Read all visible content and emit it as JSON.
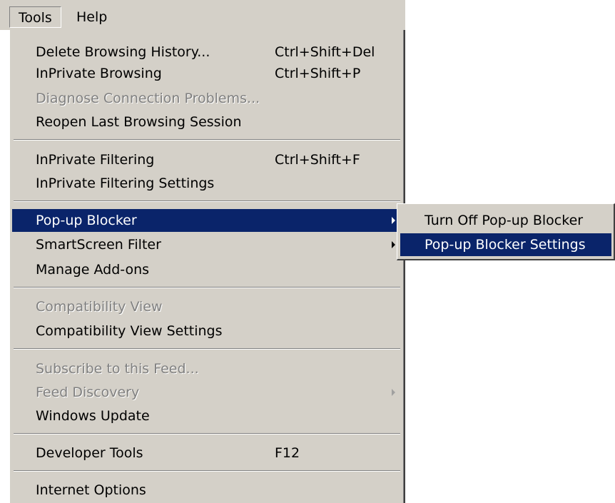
{
  "menubar": {
    "tools_label": "Tools",
    "help_label": "Help"
  },
  "tools_menu": {
    "items": [
      {
        "label": "Delete Browsing History...",
        "shortcut": "Ctrl+Shift+Del"
      },
      {
        "label": "InPrivate Browsing",
        "shortcut": "Ctrl+Shift+P"
      },
      {
        "label": "Diagnose Connection Problems...",
        "disabled": true
      },
      {
        "label": "Reopen Last Browsing Session"
      },
      {
        "label": "InPrivate Filtering",
        "shortcut": "Ctrl+Shift+F"
      },
      {
        "label": "InPrivate Filtering Settings"
      },
      {
        "label": "Pop-up Blocker",
        "submenu": true,
        "selected": true
      },
      {
        "label": "SmartScreen Filter",
        "submenu": true
      },
      {
        "label": "Manage Add-ons"
      },
      {
        "label": "Compatibility View",
        "disabled": true
      },
      {
        "label": "Compatibility View Settings"
      },
      {
        "label": "Subscribe to this Feed...",
        "disabled": true
      },
      {
        "label": "Feed Discovery",
        "submenu": true,
        "disabled": true
      },
      {
        "label": "Windows Update"
      },
      {
        "label": "Developer Tools",
        "shortcut": "F12"
      },
      {
        "label": "Internet Options"
      }
    ]
  },
  "popup_blocker_submenu": {
    "items": [
      {
        "label": "Turn Off Pop-up Blocker"
      },
      {
        "label": "Pop-up Blocker Settings",
        "selected": true
      }
    ]
  },
  "colors": {
    "menu_background": "#d4d0c8",
    "highlight": "#0a246a",
    "highlight_text": "#ffffff",
    "disabled_text": "#808080"
  }
}
